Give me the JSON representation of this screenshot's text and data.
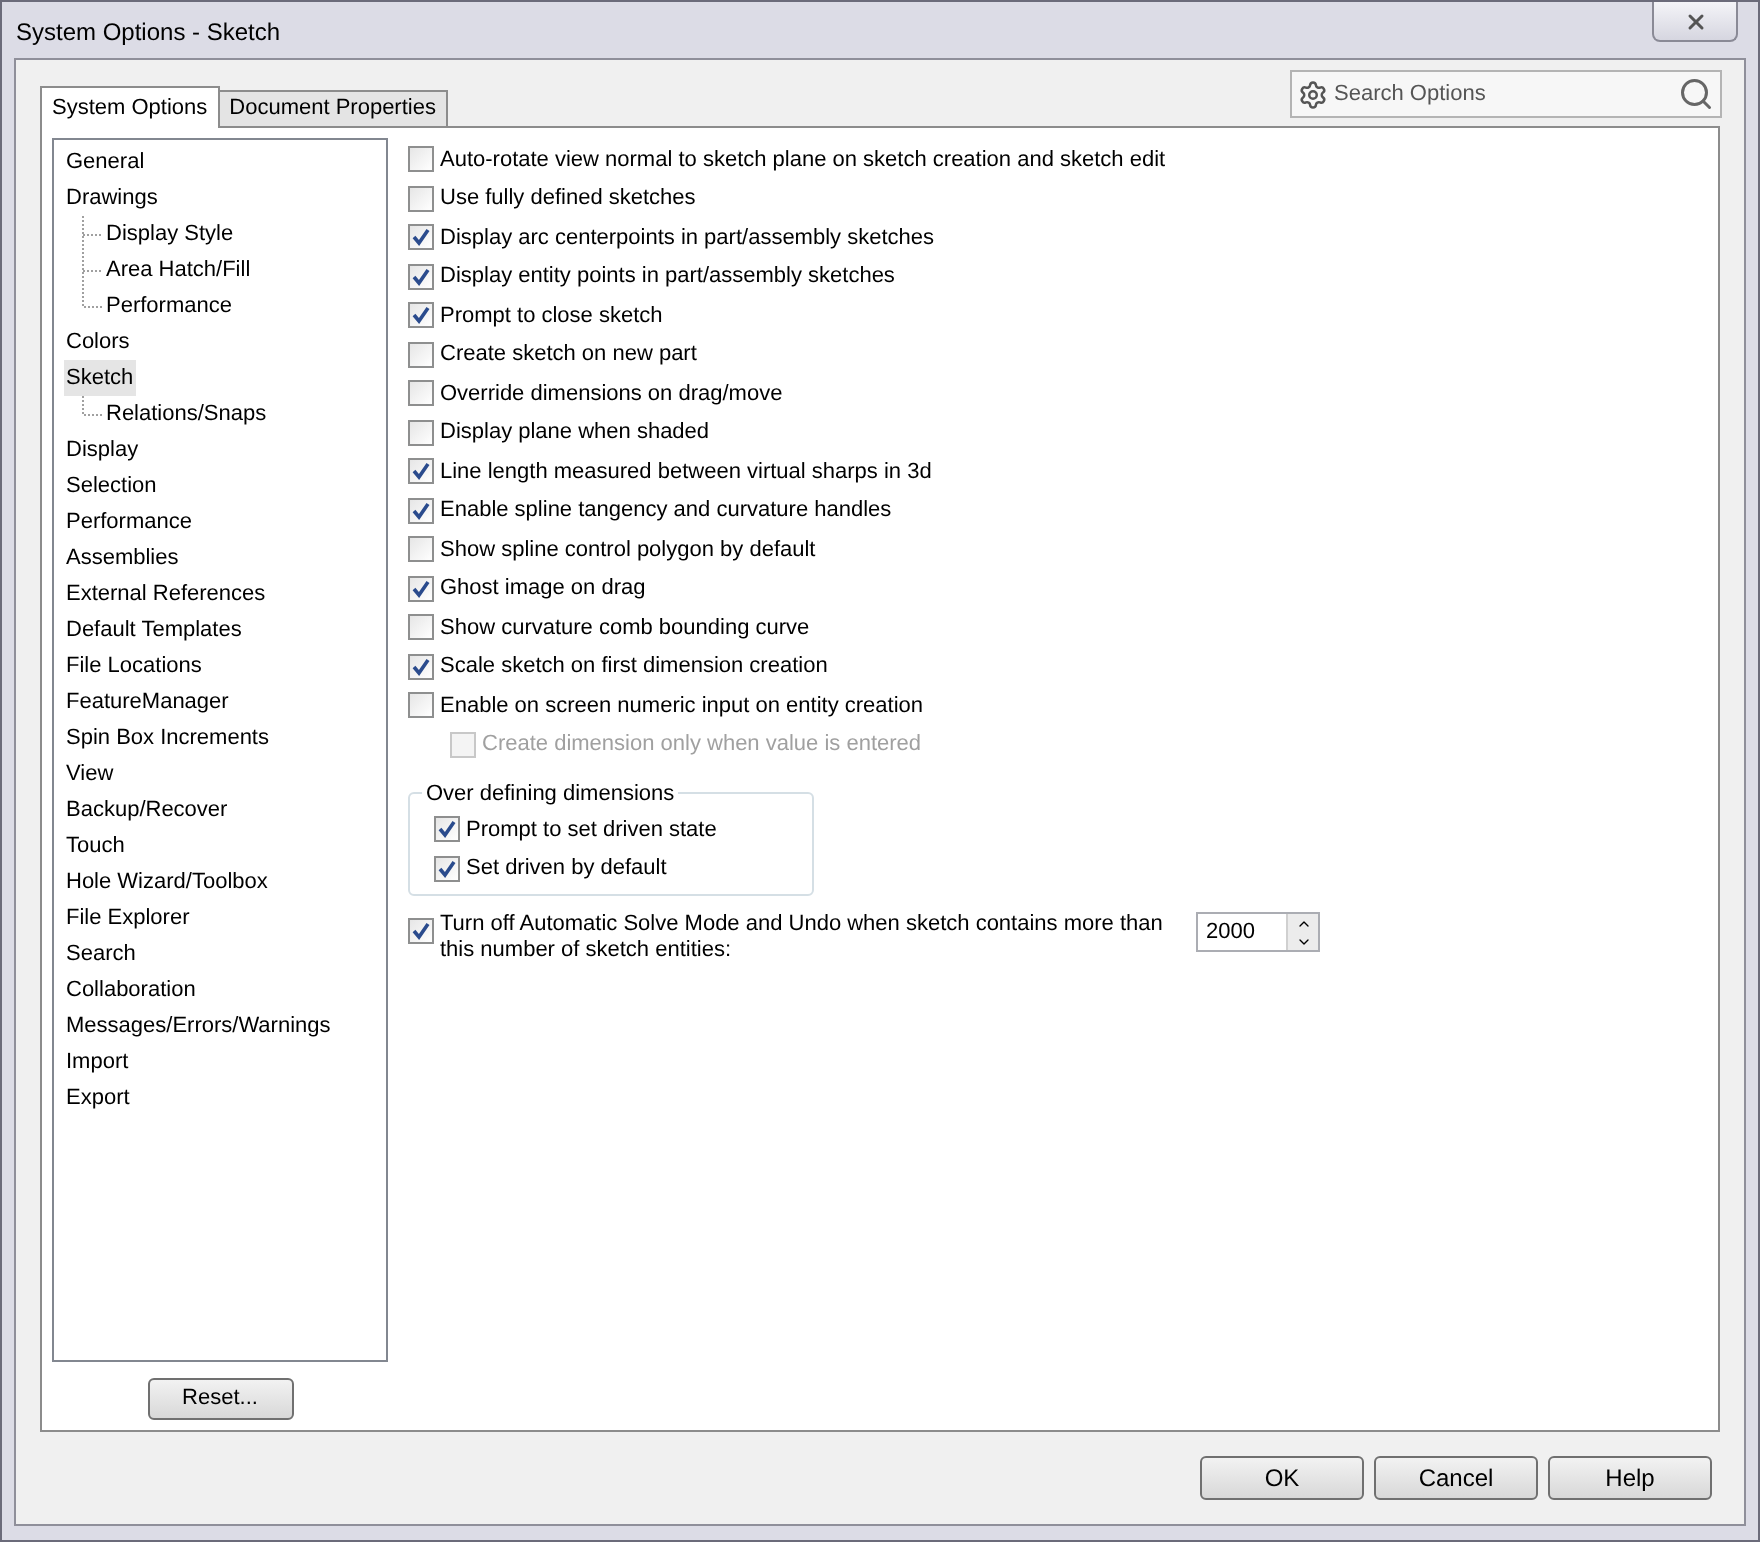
{
  "window": {
    "title": "System Options - Sketch"
  },
  "tabs": [
    {
      "label": "System Options",
      "selected": true
    },
    {
      "label": "Document Properties",
      "selected": false
    }
  ],
  "search": {
    "placeholder": "Search Options"
  },
  "sidebar": {
    "items": [
      {
        "label": "General",
        "selected": false
      },
      {
        "label": "Drawings",
        "selected": false,
        "children": [
          {
            "label": "Display Style",
            "selected": false
          },
          {
            "label": "Area Hatch/Fill",
            "selected": false
          },
          {
            "label": "Performance",
            "selected": false
          }
        ]
      },
      {
        "label": "Colors",
        "selected": false
      },
      {
        "label": "Sketch",
        "selected": true,
        "children": [
          {
            "label": "Relations/Snaps",
            "selected": false
          }
        ]
      },
      {
        "label": "Display",
        "selected": false
      },
      {
        "label": "Selection",
        "selected": false
      },
      {
        "label": "Performance",
        "selected": false
      },
      {
        "label": "Assemblies",
        "selected": false
      },
      {
        "label": "External References",
        "selected": false
      },
      {
        "label": "Default Templates",
        "selected": false
      },
      {
        "label": "File Locations",
        "selected": false
      },
      {
        "label": "FeatureManager",
        "selected": false
      },
      {
        "label": "Spin Box Increments",
        "selected": false
      },
      {
        "label": "View",
        "selected": false
      },
      {
        "label": "Backup/Recover",
        "selected": false
      },
      {
        "label": "Touch",
        "selected": false
      },
      {
        "label": "Hole Wizard/Toolbox",
        "selected": false
      },
      {
        "label": "File Explorer",
        "selected": false
      },
      {
        "label": "Search",
        "selected": false
      },
      {
        "label": "Collaboration",
        "selected": false
      },
      {
        "label": "Messages/Errors/Warnings",
        "selected": false
      },
      {
        "label": "Import",
        "selected": false
      },
      {
        "label": "Export",
        "selected": false
      }
    ],
    "reset_button": "Reset..."
  },
  "options": [
    {
      "label": "Auto-rotate view normal to sketch plane on sketch creation and sketch edit",
      "checked": false
    },
    {
      "label": "Use fully defined sketches",
      "checked": false
    },
    {
      "label": "Display arc centerpoints in part/assembly sketches",
      "checked": true
    },
    {
      "label": "Display entity points in part/assembly sketches",
      "checked": true
    },
    {
      "label": "Prompt to close sketch",
      "checked": true
    },
    {
      "label": "Create sketch on new part",
      "checked": false
    },
    {
      "label": "Override dimensions on drag/move",
      "checked": false
    },
    {
      "label": "Display plane when shaded",
      "checked": false
    },
    {
      "label": "Line length measured between virtual sharps in 3d",
      "checked": true
    },
    {
      "label": "Enable spline tangency and curvature handles",
      "checked": true
    },
    {
      "label": "Show spline control polygon by default",
      "checked": false
    },
    {
      "label": "Ghost image on drag",
      "checked": true
    },
    {
      "label": "Show curvature comb bounding curve",
      "checked": false
    },
    {
      "label": "Scale sketch on first dimension creation",
      "checked": true
    },
    {
      "label": "Enable on screen numeric input on entity creation",
      "checked": false,
      "children": [
        {
          "label": "Create dimension only when value is entered",
          "checked": false,
          "disabled": true
        }
      ]
    }
  ],
  "group": {
    "title": "Over defining dimensions",
    "options": [
      {
        "label": "Prompt to set driven state",
        "checked": true
      },
      {
        "label": "Set driven by default",
        "checked": true
      }
    ]
  },
  "solve_option": {
    "label": "Turn off Automatic Solve Mode and Undo when sketch contains more than this number of sketch entities:",
    "checked": true,
    "value": "2000"
  },
  "buttons": [
    "OK",
    "Cancel",
    "Help"
  ]
}
